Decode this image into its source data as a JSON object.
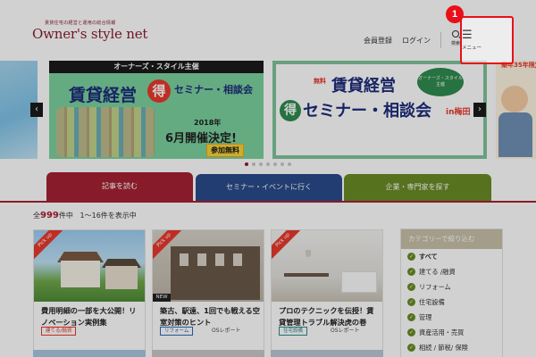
{
  "header": {
    "logo_tagline": "賃貸住宅の経営と運用の総合情報",
    "logo_text": "Owner's style net",
    "register_label": "会員登録",
    "login_label": "ログイン",
    "search_label": "検索",
    "menu_label": "メニュー"
  },
  "carousel": {
    "slide_main": {
      "band": "オーナーズ・スタイル主催",
      "title": "賃貸経営",
      "circle": "得",
      "sub": "セミナー・相談会",
      "year": "2018年",
      "date": "6月開催決定!",
      "badge": "参加無料"
    },
    "slide_second": {
      "free": "無料",
      "title": "賃貸経営",
      "host": "オーナーズ・スタイル主催",
      "circle": "得",
      "sub": "セミナー・相談会",
      "place": "in梅田"
    },
    "slide_right": {
      "text": "築年35年限定"
    },
    "prev_label": "‹",
    "next_label": "›",
    "dot_count": 7,
    "active_dot": 0
  },
  "tabs": {
    "read": "記事を読む",
    "seminar": "セミナー・イベントに行く",
    "company": "企業・専門家を探す"
  },
  "results": {
    "prefix": "全",
    "total": "999",
    "suffix": "件中",
    "range": "1〜16件を表示中"
  },
  "cards": [
    {
      "pickup": "Pick up",
      "title": "費用明細の一部を大公開！リノベーション実例集",
      "tag": "建てる/融資",
      "author": ""
    },
    {
      "pickup": "Pick up",
      "new": "NEW",
      "title": "築古、駅遠、1回でも戦える空室対策のヒント",
      "tag": "リフォーム",
      "author": "OSレポート"
    },
    {
      "pickup": "Pick up",
      "title": "プロのテクニックを伝授！賃貸管理トラブル解決虎の巻",
      "tag": "住宅設備",
      "author": "OSレポート"
    }
  ],
  "sidebar": {
    "heading": "カテゴリーで絞り込む",
    "items": [
      "すべて",
      "建てる /融資",
      "リフォーム",
      "住宅設備",
      "管理",
      "資産活用・売買",
      "相続 / 節税/ 保険"
    ]
  },
  "annotation": {
    "step": "1"
  },
  "colors": {
    "brand": "#8a1d2c",
    "tab_read": "#a62233",
    "tab_seminar": "#2a4b8c",
    "tab_company": "#6a8c25",
    "highlight": "#e8101a"
  }
}
